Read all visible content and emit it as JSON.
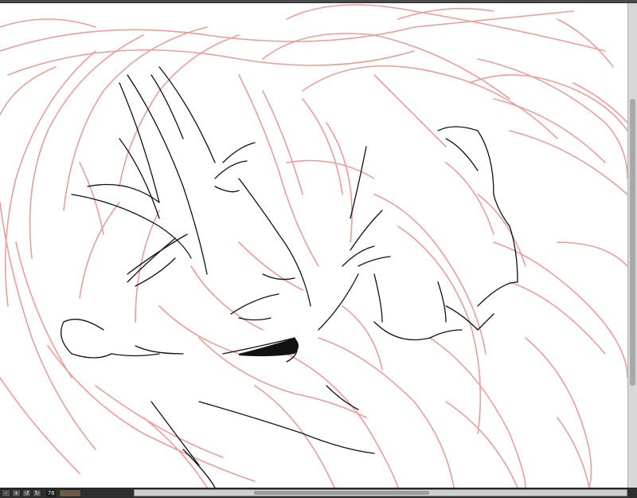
{
  "statusbar": {
    "zoom_label": "70",
    "buttons": [
      "-",
      "+",
      "↺",
      "↻"
    ]
  },
  "colors": {
    "sketch_line": "#e8948f",
    "ink_line": "#111111",
    "canvas_bg": "#ffffff"
  },
  "icons": {
    "zoom_out": "minus-icon",
    "zoom_in": "plus-icon",
    "rotate_left": "rotate-left-icon",
    "rotate_right": "rotate-right-icon"
  }
}
